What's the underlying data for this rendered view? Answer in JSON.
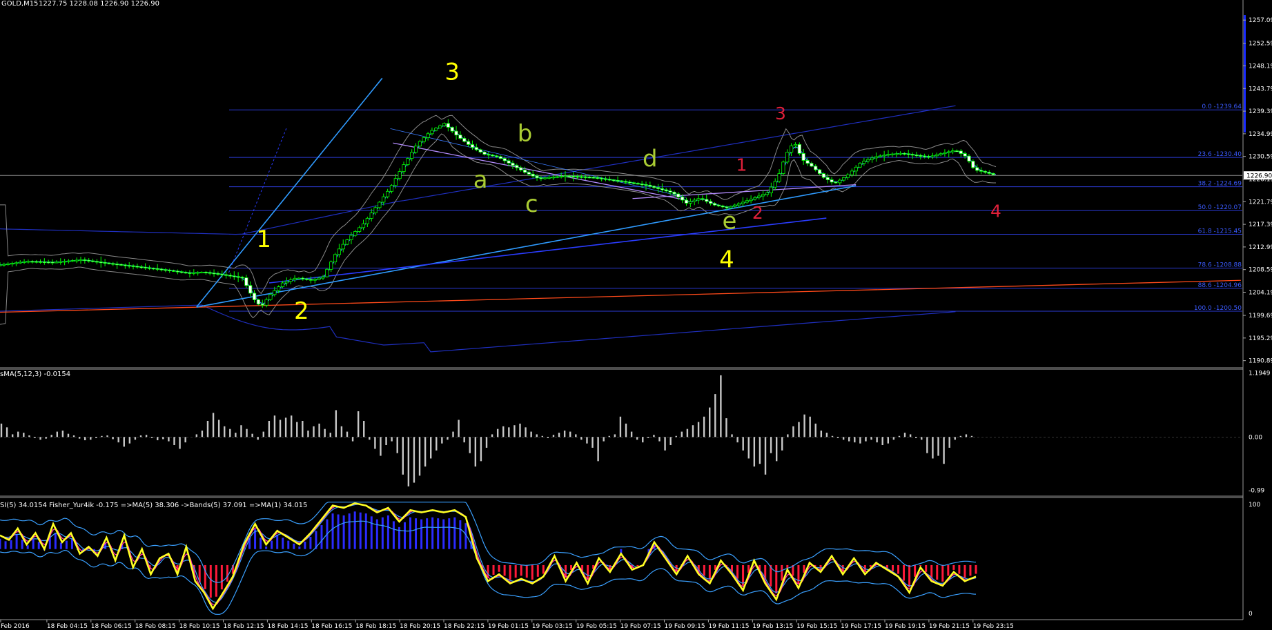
{
  "header": {
    "symbol": "GOLD,M15",
    "ohlc": "1227.75 1228.08 1226.90 1226.90",
    "macd_label": "sMA(5,12,3) -0.0154",
    "rsi_label": "SI(5) 34.0154  Fisher_Yur4ik -0.175  =>MA(5) 38.306  ->Bands(5) 37.091  =>MA(1) 34.015"
  },
  "colors": {
    "background": "#000000",
    "candle_up": "#00ff00",
    "candle_body": "#ffffff",
    "bollinger": "#8a8a8a",
    "ma": "#3a7bff",
    "channel": "#1f2fbf",
    "fib_line": "#2b3bd6",
    "trend_light": "#2f9bff",
    "red_line": "#ff4a1a",
    "wave_yellow": "#ffff00",
    "wave_green": "#aacc33",
    "wave_red": "#e0203a",
    "rsi_yellow": "#ffff22",
    "hist_blue": "#2b2bff",
    "hist_red": "#ff1a3a",
    "macd_hist": "#c8c8c8"
  },
  "chart_data": [
    {
      "type": "candlestick",
      "title": "GOLD,M15",
      "price_axis": {
        "ylim": [
          1189.5,
          1261.0
        ],
        "ticks": [
          "1257.09",
          "1252.59",
          "1248.19",
          "1243.79",
          "1239.39",
          "1234.99",
          "1230.59",
          "1226.19",
          "1221.79",
          "1217.39",
          "1212.99",
          "1208.59",
          "1204.19",
          "1199.69",
          "1195.29",
          "1190.89"
        ],
        "current_price": "1226.90"
      },
      "time_axis": {
        "ticks": [
          "Feb 2016",
          "18 Feb 04:15",
          "18 Feb 06:15",
          "18 Feb 08:15",
          "18 Feb 10:15",
          "18 Feb 12:15",
          "18 Feb 14:15",
          "18 Feb 16:15",
          "18 Feb 18:15",
          "18 Feb 20:15",
          "18 Feb 22:15",
          "19 Feb 01:15",
          "19 Feb 03:15",
          "19 Feb 05:15",
          "19 Feb 07:15",
          "19 Feb 09:15",
          "19 Feb 11:15",
          "19 Feb 13:15",
          "19 Feb 15:15",
          "19 Feb 17:15",
          "19 Feb 19:15",
          "19 Feb 21:15",
          "19 Feb 23:15"
        ]
      },
      "close_path": [
        [
          0,
          1209.5
        ],
        [
          20,
          1210.2
        ],
        [
          40,
          1210.0
        ],
        [
          60,
          1210.5
        ],
        [
          80,
          1209.8
        ],
        [
          100,
          1209.2
        ],
        [
          120,
          1208.6
        ],
        [
          140,
          1207.9
        ],
        [
          150,
          1208.1
        ],
        [
          160,
          1207.8
        ],
        [
          180,
          1207.0
        ],
        [
          188,
          1203.0
        ],
        [
          194,
          1201.3
        ],
        [
          200,
          1203.5
        ],
        [
          210,
          1206.0
        ],
        [
          220,
          1207.0
        ],
        [
          232,
          1206.5
        ],
        [
          240,
          1207.2
        ],
        [
          250,
          1212.0
        ],
        [
          260,
          1215.0
        ],
        [
          270,
          1217.5
        ],
        [
          280,
          1221.0
        ],
        [
          290,
          1224.5
        ],
        [
          300,
          1229.0
        ],
        [
          310,
          1233.0
        ],
        [
          320,
          1235.5
        ],
        [
          330,
          1237.0
        ],
        [
          340,
          1234.5
        ],
        [
          350,
          1232.5
        ],
        [
          360,
          1231.0
        ],
        [
          370,
          1230.5
        ],
        [
          380,
          1229.0
        ],
        [
          390,
          1227.5
        ],
        [
          400,
          1226.3
        ],
        [
          420,
          1226.8
        ],
        [
          440,
          1226.5
        ],
        [
          460,
          1225.8
        ],
        [
          480,
          1225.0
        ],
        [
          500,
          1223.5
        ],
        [
          510,
          1221.5
        ],
        [
          520,
          1222.5
        ],
        [
          530,
          1221.2
        ],
        [
          540,
          1220.6
        ],
        [
          550,
          1221.5
        ],
        [
          560,
          1222.5
        ],
        [
          570,
          1223.5
        ],
        [
          578,
          1226.5
        ],
        [
          584,
          1231.0
        ],
        [
          590,
          1233.5
        ],
        [
          596,
          1230.0
        ],
        [
          604,
          1228.5
        ],
        [
          612,
          1226.5
        ],
        [
          620,
          1225.3
        ],
        [
          630,
          1227.0
        ],
        [
          640,
          1229.5
        ],
        [
          650,
          1230.5
        ],
        [
          660,
          1231.0
        ],
        [
          670,
          1231.2
        ],
        [
          680,
          1230.8
        ],
        [
          690,
          1230.5
        ],
        [
          700,
          1231.2
        ],
        [
          710,
          1231.8
        ],
        [
          718,
          1230.5
        ],
        [
          724,
          1228.0
        ],
        [
          732,
          1227.5
        ],
        [
          740,
          1226.9
        ]
      ],
      "fibonacci": [
        {
          "label": "0.0 -1239.64",
          "price": 1239.64
        },
        {
          "label": "23.6 -1230.40",
          "price": 1230.4
        },
        {
          "label": "38.2 -1224.69",
          "price": 1224.69
        },
        {
          "label": "50.0 -1220.07",
          "price": 1220.07
        },
        {
          "label": "61.8 -1215.45",
          "price": 1215.45
        },
        {
          "label": "78.6 -1208.88",
          "price": 1208.88
        },
        {
          "label": "88.6 -1204.96",
          "price": 1204.96
        },
        {
          "label": "100.0 -1200.50",
          "price": 1200.5
        }
      ],
      "annotations": [
        {
          "text": "1",
          "color": "yellow",
          "size": "large",
          "bar": 196,
          "price": 1213.0
        },
        {
          "text": "2",
          "color": "yellow",
          "size": "large",
          "bar": 224,
          "price": 1199.0
        },
        {
          "text": "3",
          "color": "yellow",
          "size": "large",
          "bar": 336,
          "price": 1245.5
        },
        {
          "text": "4",
          "color": "yellow",
          "size": "large",
          "bar": 540,
          "price": 1209.0
        },
        {
          "text": "a",
          "color": "green",
          "size": "large",
          "bar": 357,
          "price": 1224.5
        },
        {
          "text": "b",
          "color": "green",
          "size": "large",
          "bar": 390,
          "price": 1233.5
        },
        {
          "text": "c",
          "color": "green",
          "size": "large",
          "bar": 395,
          "price": 1219.8
        },
        {
          "text": "d",
          "color": "green",
          "size": "large",
          "bar": 483,
          "price": 1228.6
        },
        {
          "text": "e",
          "color": "green",
          "size": "large",
          "bar": 542,
          "price": 1216.5
        },
        {
          "text": "1",
          "color": "red",
          "size": "small",
          "bar": 551,
          "price": 1227.8
        },
        {
          "text": "2",
          "color": "red",
          "size": "small",
          "bar": 563,
          "price": 1218.5
        },
        {
          "text": "3",
          "color": "red",
          "size": "small",
          "bar": 580,
          "price": 1237.8
        },
        {
          "text": "4",
          "color": "red",
          "size": "small",
          "bar": 740,
          "price": 1218.8
        }
      ]
    },
    {
      "type": "bar",
      "title": "sMA(5,12,3) -0.0154",
      "axis_ticks": [
        "1.1949",
        "0.00",
        "-0.99"
      ],
      "ylim": [
        -1.05,
        1.2
      ],
      "values": [
        0.25,
        0.18,
        0.05,
        0.1,
        0.08,
        0.03,
        -0.02,
        -0.05,
        -0.03,
        0.04,
        0.1,
        0.12,
        0.06,
        0.03,
        -0.03,
        -0.06,
        -0.05,
        -0.02,
        0.02,
        0.03,
        -0.04,
        -0.1,
        -0.18,
        -0.12,
        -0.05,
        0.03,
        0.04,
        -0.02,
        -0.06,
        -0.04,
        -0.08,
        -0.15,
        -0.22,
        -0.1,
        0.0,
        0.05,
        0.12,
        0.3,
        0.45,
        0.32,
        0.2,
        0.15,
        0.08,
        0.22,
        0.15,
        0.06,
        -0.05,
        0.1,
        0.3,
        0.4,
        0.32,
        0.36,
        0.4,
        0.28,
        0.3,
        0.12,
        0.2,
        0.25,
        0.15,
        0.08,
        0.5,
        0.2,
        0.1,
        -0.08,
        0.48,
        0.3,
        -0.05,
        -0.22,
        -0.35,
        -0.15,
        -0.08,
        -0.3,
        -0.7,
        -0.92,
        -0.85,
        -0.72,
        -0.55,
        -0.4,
        -0.25,
        -0.12,
        -0.05,
        0.1,
        0.32,
        -0.1,
        -0.3,
        -0.55,
        -0.45,
        -0.2,
        0.05,
        0.15,
        0.2,
        0.18,
        0.22,
        0.25,
        0.18,
        0.1,
        0.05,
        0.02,
        -0.02,
        0.04,
        0.08,
        0.12,
        0.1,
        0.05,
        -0.05,
        -0.12,
        -0.2,
        -0.45,
        -0.08,
        0.02,
        0.05,
        0.38,
        0.25,
        0.1,
        -0.05,
        -0.1,
        -0.02,
        0.04,
        -0.08,
        -0.25,
        -0.15,
        0.02,
        0.1,
        0.15,
        0.22,
        0.28,
        0.38,
        0.55,
        0.8,
        1.15,
        0.35,
        0.05,
        -0.1,
        -0.25,
        -0.4,
        -0.55,
        -0.5,
        -0.7,
        -0.3,
        -0.45,
        -0.25,
        0.05,
        0.2,
        0.28,
        0.42,
        0.38,
        0.25,
        0.12,
        0.08,
        0.02,
        -0.02,
        -0.05,
        -0.08,
        -0.1,
        -0.12,
        -0.08,
        -0.05,
        -0.1,
        -0.15,
        -0.12,
        -0.05,
        0.02,
        0.08,
        0.05,
        -0.02,
        -0.05,
        -0.3,
        -0.4,
        -0.35,
        -0.5,
        -0.2,
        -0.05,
        0.02,
        0.05,
        0.02
      ]
    },
    {
      "type": "line",
      "title": "SI(5) 34.0154  Fisher_Yur4ik -0.175  =>MA(5) 38.306  ->Bands(5) 37.091  =>MA(1) 34.015",
      "axis_ticks": [
        "100",
        "0"
      ],
      "ylim": [
        0,
        100
      ],
      "rsi_points": [
        [
          0,
          70
        ],
        [
          8,
          66
        ],
        [
          16,
          76
        ],
        [
          24,
          62
        ],
        [
          32,
          72
        ],
        [
          40,
          58
        ],
        [
          48,
          80
        ],
        [
          56,
          64
        ],
        [
          64,
          72
        ],
        [
          72,
          54
        ],
        [
          80,
          60
        ],
        [
          88,
          52
        ],
        [
          96,
          68
        ],
        [
          104,
          48
        ],
        [
          112,
          70
        ],
        [
          120,
          42
        ],
        [
          128,
          58
        ],
        [
          136,
          36
        ],
        [
          144,
          50
        ],
        [
          152,
          54
        ],
        [
          160,
          36
        ],
        [
          168,
          60
        ],
        [
          176,
          30
        ],
        [
          184,
          20
        ],
        [
          192,
          6
        ],
        [
          200,
          18
        ],
        [
          210,
          34
        ],
        [
          220,
          62
        ],
        [
          230,
          80
        ],
        [
          240,
          62
        ],
        [
          250,
          74
        ],
        [
          260,
          68
        ],
        [
          270,
          62
        ],
        [
          280,
          72
        ],
        [
          290,
          84
        ],
        [
          300,
          96
        ],
        [
          310,
          94
        ],
        [
          320,
          98
        ],
        [
          330,
          96
        ],
        [
          340,
          90
        ],
        [
          350,
          94
        ],
        [
          360,
          82
        ],
        [
          370,
          92
        ],
        [
          380,
          90
        ],
        [
          390,
          92
        ],
        [
          400,
          90
        ],
        [
          410,
          92
        ],
        [
          420,
          86
        ],
        [
          430,
          50
        ],
        [
          440,
          30
        ],
        [
          450,
          36
        ],
        [
          460,
          28
        ],
        [
          470,
          32
        ],
        [
          480,
          28
        ],
        [
          490,
          34
        ],
        [
          500,
          52
        ],
        [
          510,
          30
        ],
        [
          520,
          46
        ],
        [
          530,
          28
        ],
        [
          540,
          50
        ],
        [
          550,
          38
        ],
        [
          560,
          54
        ],
        [
          570,
          40
        ],
        [
          580,
          44
        ],
        [
          590,
          64
        ],
        [
          600,
          50
        ],
        [
          610,
          36
        ],
        [
          620,
          52
        ],
        [
          630,
          36
        ],
        [
          640,
          28
        ],
        [
          650,
          48
        ],
        [
          660,
          36
        ],
        [
          670,
          22
        ],
        [
          680,
          48
        ],
        [
          690,
          28
        ],
        [
          700,
          14
        ],
        [
          710,
          40
        ],
        [
          720,
          24
        ],
        [
          730,
          46
        ],
        [
          740,
          38
        ],
        [
          750,
          52
        ],
        [
          760,
          36
        ],
        [
          770,
          50
        ],
        [
          780,
          36
        ],
        [
          790,
          46
        ],
        [
          800,
          40
        ],
        [
          810,
          34
        ],
        [
          820,
          20
        ],
        [
          830,
          42
        ],
        [
          840,
          30
        ],
        [
          850,
          26
        ],
        [
          860,
          38
        ],
        [
          870,
          30
        ],
        [
          880,
          34
        ]
      ]
    }
  ]
}
